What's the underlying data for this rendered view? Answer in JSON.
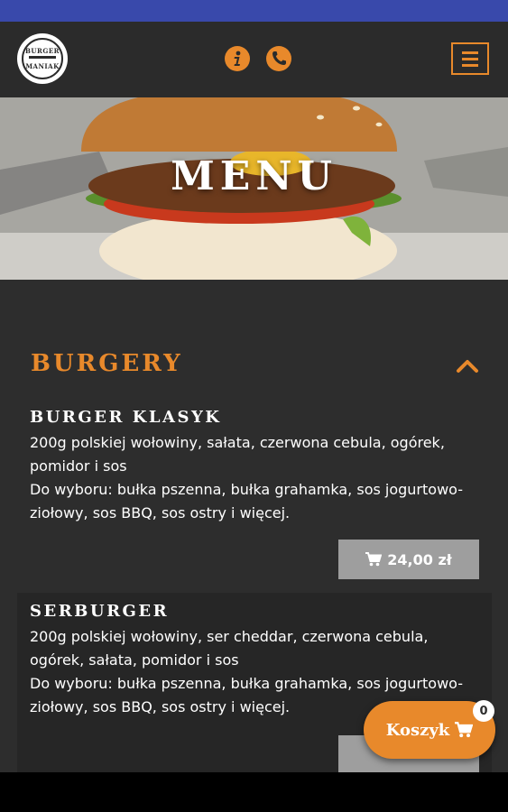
{
  "header": {
    "logo_top_text": "BURGER",
    "logo_bottom_text": "MANIAK",
    "icons": [
      "info-icon",
      "phone-icon",
      "hamburger-menu-icon"
    ]
  },
  "hero": {
    "title": "MENU"
  },
  "category": {
    "title": "BURGERY",
    "state": "expanded"
  },
  "items": [
    {
      "name": "BURGER KLASYK",
      "description_line1": "200g polskiej wołowiny, sałata, czerwona cebula, ogórek, pomidor i sos",
      "description_line2": "Do wyboru: bułka pszenna, bułka grahamka, sos jogurtowo-ziołowy, sos BBQ, sos ostry i więcej.",
      "price": "24,00 zł"
    },
    {
      "name": "SERBURGER",
      "description_line1": "200g polskiej wołowiny, ser cheddar, czerwona cebula, ogórek, sałata, pomidor i sos",
      "description_line2": "Do wyboru: bułka pszenna, bułka grahamka, sos jogurtowo-ziołowy, sos BBQ, sos ostry i więcej."
    }
  ],
  "cart": {
    "label": "Koszyk",
    "count": "0"
  },
  "colors": {
    "accent": "#e8892b",
    "background": "#2d2d2d",
    "status_bar": "#3949ab",
    "price_button": "#9e9e9e"
  }
}
